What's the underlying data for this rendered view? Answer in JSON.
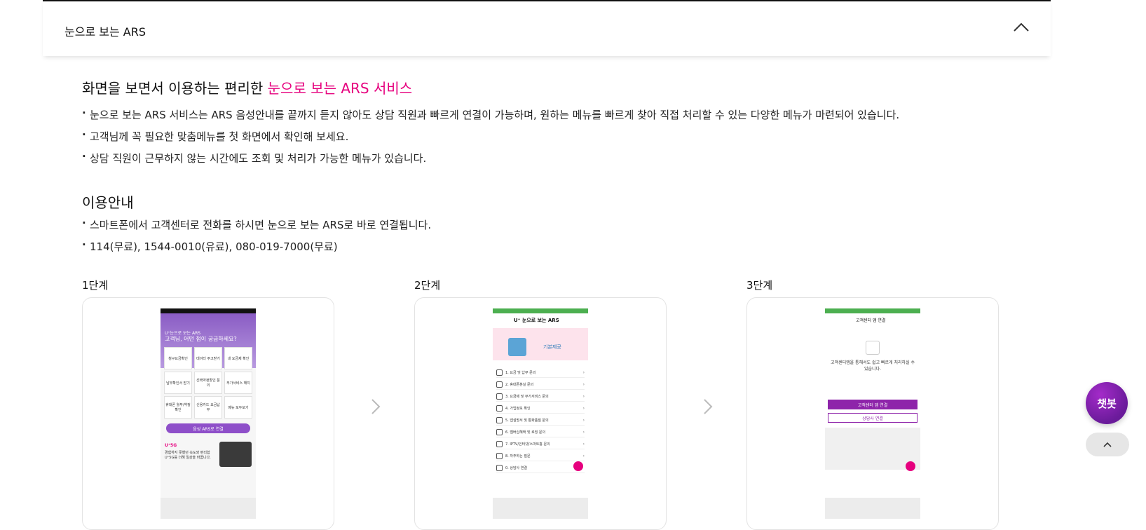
{
  "accordion": {
    "title": "눈으로 보는 ARS"
  },
  "intro": {
    "heading_prefix": "화면을 보면서 이용하는 편리한 ",
    "heading_accent": "눈으로 보는 ARS 서비스",
    "bullets": [
      "눈으로 보는 ARS 서비스는 ARS 음성안내를 끝까지 듣지 않아도 상담 직원과 빠르게 연결이 가능하며, 원하는 메뉴를 빠르게 찾아 직접 처리할 수 있는 다양한 메뉴가 마련되어 있습니다.",
      "고객님께 꼭 필요한 맞춤메뉴를 첫 화면에서 확인해 보세요.",
      "상담 직원이 근무하지 않는 시간에도 조회 및 처리가 가능한 메뉴가 있습니다."
    ]
  },
  "guide": {
    "heading": "이용안내",
    "bullets": [
      "스마트폰에서 고객센터로 전화를 하시면 눈으로 보는 ARS로 바로 연결됩니다.",
      "114(무료), 1544-0010(유료), 080-019-7000(무료)"
    ]
  },
  "steps": [
    {
      "label": "1단계"
    },
    {
      "label": "2단계"
    },
    {
      "label": "3단계"
    }
  ],
  "phone1": {
    "brand": "U⁺눈으로 보는 ARS",
    "greeting": "고객님, 어떤 점이 궁금하세요?",
    "tiles": [
      "청구요금확인",
      "데이터 주고받기",
      "내 요금제 확인",
      "납부확인서 받기",
      "선택약정할인 문의",
      "부가서비스 해지",
      "휴대폰 월부/약정 확인",
      "신용카드 요금납부",
      "메뉴 모두보기"
    ],
    "voice_btn": "음성 ARS로 연결",
    "promo_title": "U⁺5G",
    "promo_text": "경험하지 못했던 속도와 편리함 U⁺5G를 더해 일상을 바꿉니다."
  },
  "phone2": {
    "title": "U⁺ 눈으로 보는 ARS",
    "banner": "기본제공",
    "menus": [
      "1. 요금 및 납부 문의",
      "2. 휴대폰분실 문의",
      "3. 요금제 및 부가서비스 문의",
      "4. 가입정보 확인",
      "5. 앱설명서 및 통화품질 문의",
      "6. 멤버십혜택 및 로밍 문의",
      "7. IPTV/인터넷/스마트홈 문의",
      "8. 자주하는 질문",
      "0. 상담사 연결"
    ]
  },
  "phone3": {
    "title": "고객센터 앱 연결",
    "message": "고객센터앱을 통해서도 쉽고 빠르게 처리하실 수 있습니다.",
    "btn_primary": "고객센터 앱 연결",
    "btn_secondary": "상담사 연결"
  },
  "chatbot": {
    "label": "챗봇"
  },
  "colors": {
    "accent": "#e6007e",
    "purple": "#8e24aa"
  }
}
